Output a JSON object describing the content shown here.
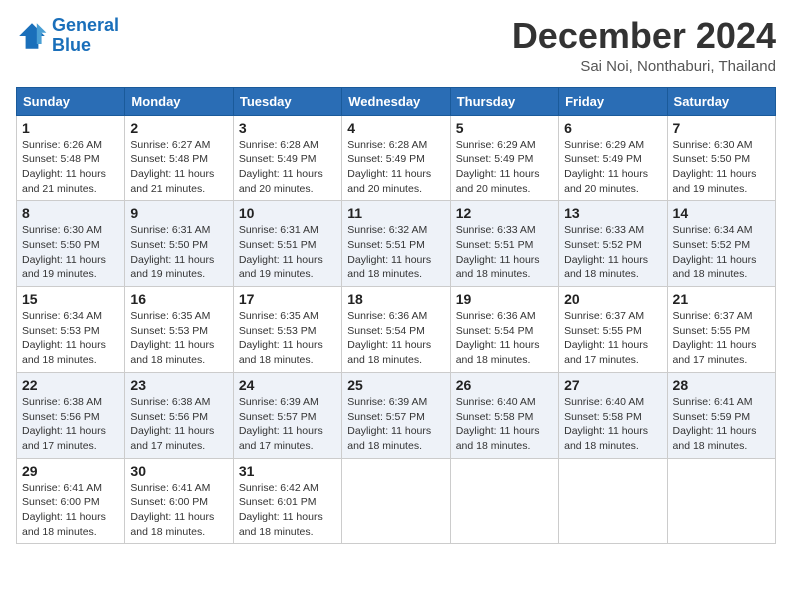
{
  "logo": {
    "line1": "General",
    "line2": "Blue"
  },
  "title": "December 2024",
  "subtitle": "Sai Noi, Nonthaburi, Thailand",
  "headers": [
    "Sunday",
    "Monday",
    "Tuesday",
    "Wednesday",
    "Thursday",
    "Friday",
    "Saturday"
  ],
  "weeks": [
    [
      {
        "day": "1",
        "sunrise": "6:26 AM",
        "sunset": "5:48 PM",
        "daylight": "11 hours and 21 minutes."
      },
      {
        "day": "2",
        "sunrise": "6:27 AM",
        "sunset": "5:48 PM",
        "daylight": "11 hours and 21 minutes."
      },
      {
        "day": "3",
        "sunrise": "6:28 AM",
        "sunset": "5:49 PM",
        "daylight": "11 hours and 20 minutes."
      },
      {
        "day": "4",
        "sunrise": "6:28 AM",
        "sunset": "5:49 PM",
        "daylight": "11 hours and 20 minutes."
      },
      {
        "day": "5",
        "sunrise": "6:29 AM",
        "sunset": "5:49 PM",
        "daylight": "11 hours and 20 minutes."
      },
      {
        "day": "6",
        "sunrise": "6:29 AM",
        "sunset": "5:49 PM",
        "daylight": "11 hours and 20 minutes."
      },
      {
        "day": "7",
        "sunrise": "6:30 AM",
        "sunset": "5:50 PM",
        "daylight": "11 hours and 19 minutes."
      }
    ],
    [
      {
        "day": "8",
        "sunrise": "6:30 AM",
        "sunset": "5:50 PM",
        "daylight": "11 hours and 19 minutes."
      },
      {
        "day": "9",
        "sunrise": "6:31 AM",
        "sunset": "5:50 PM",
        "daylight": "11 hours and 19 minutes."
      },
      {
        "day": "10",
        "sunrise": "6:31 AM",
        "sunset": "5:51 PM",
        "daylight": "11 hours and 19 minutes."
      },
      {
        "day": "11",
        "sunrise": "6:32 AM",
        "sunset": "5:51 PM",
        "daylight": "11 hours and 18 minutes."
      },
      {
        "day": "12",
        "sunrise": "6:33 AM",
        "sunset": "5:51 PM",
        "daylight": "11 hours and 18 minutes."
      },
      {
        "day": "13",
        "sunrise": "6:33 AM",
        "sunset": "5:52 PM",
        "daylight": "11 hours and 18 minutes."
      },
      {
        "day": "14",
        "sunrise": "6:34 AM",
        "sunset": "5:52 PM",
        "daylight": "11 hours and 18 minutes."
      }
    ],
    [
      {
        "day": "15",
        "sunrise": "6:34 AM",
        "sunset": "5:53 PM",
        "daylight": "11 hours and 18 minutes."
      },
      {
        "day": "16",
        "sunrise": "6:35 AM",
        "sunset": "5:53 PM",
        "daylight": "11 hours and 18 minutes."
      },
      {
        "day": "17",
        "sunrise": "6:35 AM",
        "sunset": "5:53 PM",
        "daylight": "11 hours and 18 minutes."
      },
      {
        "day": "18",
        "sunrise": "6:36 AM",
        "sunset": "5:54 PM",
        "daylight": "11 hours and 18 minutes."
      },
      {
        "day": "19",
        "sunrise": "6:36 AM",
        "sunset": "5:54 PM",
        "daylight": "11 hours and 18 minutes."
      },
      {
        "day": "20",
        "sunrise": "6:37 AM",
        "sunset": "5:55 PM",
        "daylight": "11 hours and 17 minutes."
      },
      {
        "day": "21",
        "sunrise": "6:37 AM",
        "sunset": "5:55 PM",
        "daylight": "11 hours and 17 minutes."
      }
    ],
    [
      {
        "day": "22",
        "sunrise": "6:38 AM",
        "sunset": "5:56 PM",
        "daylight": "11 hours and 17 minutes."
      },
      {
        "day": "23",
        "sunrise": "6:38 AM",
        "sunset": "5:56 PM",
        "daylight": "11 hours and 17 minutes."
      },
      {
        "day": "24",
        "sunrise": "6:39 AM",
        "sunset": "5:57 PM",
        "daylight": "11 hours and 17 minutes."
      },
      {
        "day": "25",
        "sunrise": "6:39 AM",
        "sunset": "5:57 PM",
        "daylight": "11 hours and 18 minutes."
      },
      {
        "day": "26",
        "sunrise": "6:40 AM",
        "sunset": "5:58 PM",
        "daylight": "11 hours and 18 minutes."
      },
      {
        "day": "27",
        "sunrise": "6:40 AM",
        "sunset": "5:58 PM",
        "daylight": "11 hours and 18 minutes."
      },
      {
        "day": "28",
        "sunrise": "6:41 AM",
        "sunset": "5:59 PM",
        "daylight": "11 hours and 18 minutes."
      }
    ],
    [
      {
        "day": "29",
        "sunrise": "6:41 AM",
        "sunset": "6:00 PM",
        "daylight": "11 hours and 18 minutes."
      },
      {
        "day": "30",
        "sunrise": "6:41 AM",
        "sunset": "6:00 PM",
        "daylight": "11 hours and 18 minutes."
      },
      {
        "day": "31",
        "sunrise": "6:42 AM",
        "sunset": "6:01 PM",
        "daylight": "11 hours and 18 minutes."
      },
      null,
      null,
      null,
      null
    ]
  ]
}
